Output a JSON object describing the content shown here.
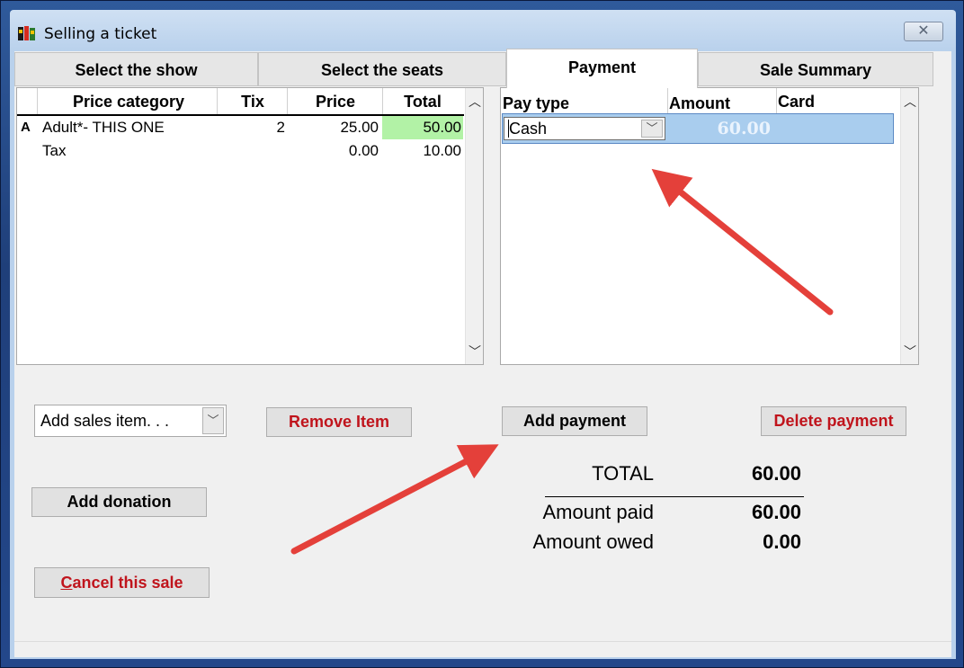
{
  "window": {
    "title": "Selling a ticket",
    "close_glyph": "✕"
  },
  "tabs": [
    {
      "label": "Select the show"
    },
    {
      "label": "Select the seats"
    },
    {
      "label": "Payment"
    },
    {
      "label": "Sale Summary"
    }
  ],
  "items_table": {
    "headers": [
      "Price category",
      "Tix",
      "Price",
      "Total"
    ],
    "rows": [
      {
        "marker": "A",
        "category": "Adult*- THIS ONE",
        "tix": "2",
        "price": "25.00",
        "total": "50.00"
      },
      {
        "marker": "",
        "category": "Tax",
        "tix": "",
        "price": "0.00",
        "total": "10.00"
      }
    ]
  },
  "payments_table": {
    "headers": [
      "Pay type",
      "Amount",
      "Card"
    ],
    "rows": [
      {
        "pay_type": "Cash",
        "amount": "60.00",
        "card": ""
      }
    ]
  },
  "controls": {
    "add_sales_item": "Add sales item. . .",
    "remove_item": "Remove Item",
    "add_payment": "Add payment",
    "delete_payment": "Delete payment",
    "add_donation": "Add donation",
    "cancel_sale_first": "C",
    "cancel_sale_rest": "ancel this sale"
  },
  "summary": {
    "total_label": "TOTAL",
    "total_value": "60.00",
    "paid_label": "Amount paid",
    "paid_value": "60.00",
    "owed_label": "Amount owed",
    "owed_value": "0.00"
  },
  "colors": {
    "highlight_total": "#b2f2a6",
    "selected_row": "#a9cdee",
    "button_text_red": "#c0141c",
    "annotation_arrow": "#e4403a"
  }
}
